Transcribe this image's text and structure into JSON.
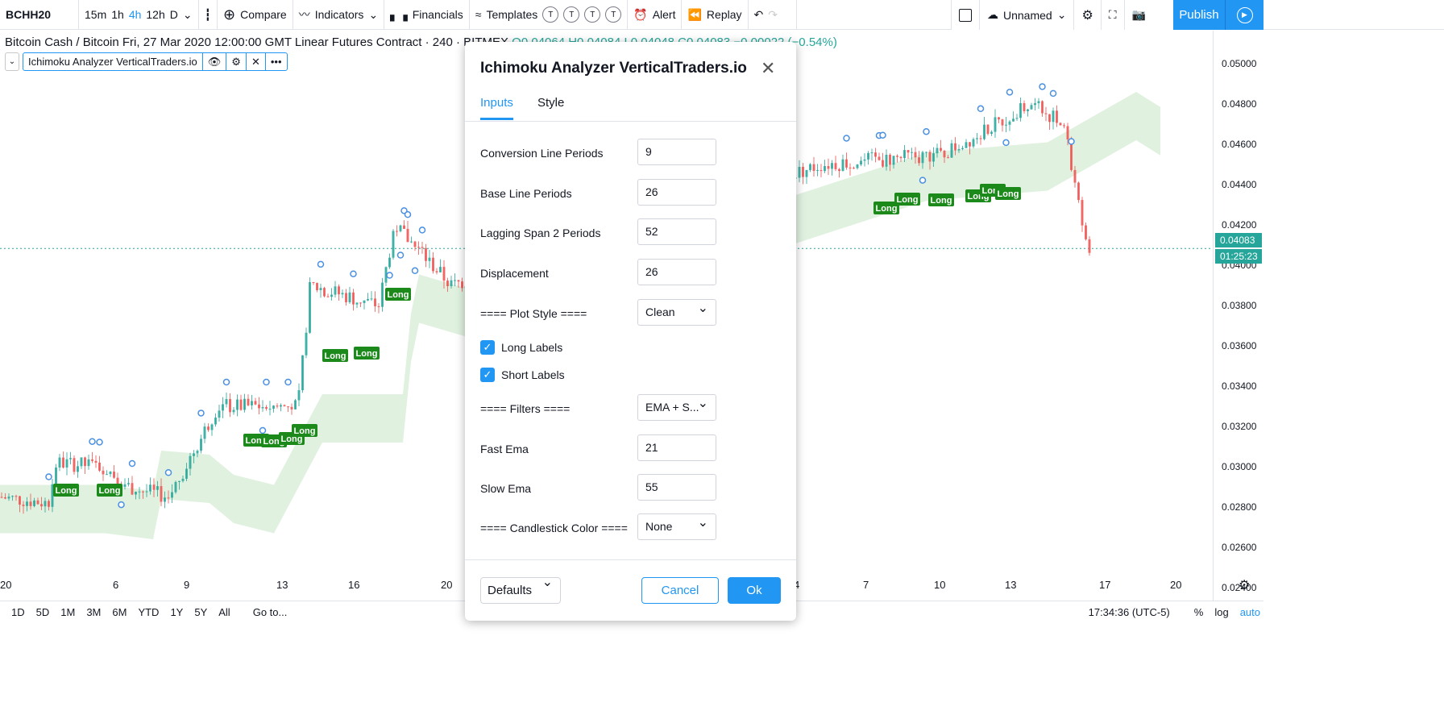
{
  "toolbar": {
    "symbol": "BCHH20",
    "intervals": [
      "15m",
      "1h",
      "4h",
      "12h",
      "D"
    ],
    "active_interval": "4h",
    "compare": "Compare",
    "indicators": "Indicators",
    "financials": "Financials",
    "templates": "Templates",
    "template_slots": [
      "T",
      "T",
      "T",
      "T"
    ],
    "alert": "Alert",
    "replay": "Replay",
    "layout_name": "Unnamed",
    "publish": "Publish"
  },
  "legend": {
    "title": "Bitcoin Cash / Bitcoin Fri, 27 Mar 2020 12:00:00 GMT Linear Futures Contract · 240 · BITMEX",
    "ohlc": "O0.04064 H0.04084 L0.04048 C0.04083 −0.00022 (−0.54%)"
  },
  "indicator": {
    "name": "Ichimoku Analyzer VerticalTraders.io"
  },
  "price_axis": {
    "labels": [
      "0.05000",
      "0.04800",
      "0.04600",
      "0.04400",
      "0.04200",
      "0.04000",
      "0.03800",
      "0.03600",
      "0.03400",
      "0.03200",
      "0.03000",
      "0.02800",
      "0.02600",
      "0.02400"
    ],
    "last_price": "0.04083",
    "countdown": "01:25:23",
    "up_color": "#26a69a",
    "down_color": "#ef5350",
    "cloud_color": "#d8eed8",
    "signal_color": "#1b8a1b"
  },
  "date_axis": {
    "labels": [
      "20",
      "6",
      "9",
      "13",
      "16",
      "20",
      "4",
      "7",
      "10",
      "13",
      "17",
      "20"
    ]
  },
  "signals": {
    "label": "Long"
  },
  "bottom": {
    "ranges": [
      "1D",
      "5D",
      "1M",
      "3M",
      "6M",
      "YTD",
      "1Y",
      "5Y",
      "All"
    ],
    "goto": "Go to...",
    "time": "17:34:36 (UTC-5)",
    "percent": "%",
    "log": "log",
    "auto": "auto"
  },
  "dialog": {
    "title": "Ichimoku Analyzer VerticalTraders.io",
    "tabs": [
      "Inputs",
      "Style"
    ],
    "inputs": [
      {
        "label": "Conversion Line Periods",
        "value": "9",
        "type": "number"
      },
      {
        "label": "Base Line Periods",
        "value": "26",
        "type": "number"
      },
      {
        "label": "Lagging Span 2 Periods",
        "value": "52",
        "type": "number"
      },
      {
        "label": "Displacement",
        "value": "26",
        "type": "number"
      },
      {
        "label": "==== Plot Style ====",
        "value": "Clean",
        "type": "select"
      },
      {
        "label": "Long Labels",
        "checked": true,
        "type": "checkbox"
      },
      {
        "label": "Short Labels",
        "checked": true,
        "type": "checkbox"
      },
      {
        "label": "==== Filters ====",
        "value": "EMA + S...",
        "type": "select"
      },
      {
        "label": "Fast Ema",
        "value": "21",
        "type": "number"
      },
      {
        "label": "Slow Ema",
        "value": "55",
        "type": "number"
      },
      {
        "label": "==== Candlestick Color ====",
        "value": "None",
        "type": "select"
      }
    ],
    "defaults": "Defaults",
    "cancel": "Cancel",
    "ok": "Ok"
  }
}
